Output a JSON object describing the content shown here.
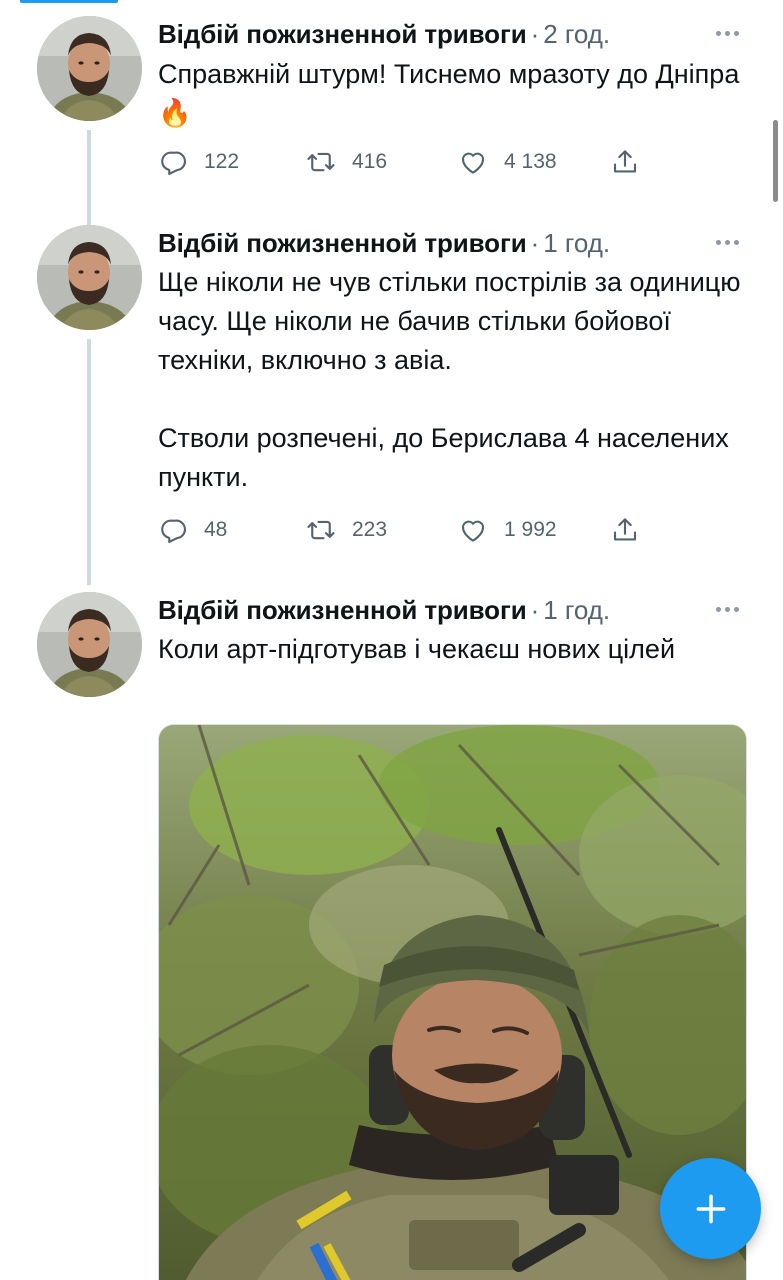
{
  "thread": [
    {
      "author": "Відбій пожизненной тривоги",
      "separator": "·",
      "time": "2 год.",
      "text": "Справжній штурм! Тиснемо мразоту до Дніпра 🔥",
      "replies": "122",
      "retweets": "416",
      "likes": "4 138"
    },
    {
      "author": "Відбій пожизненной тривоги",
      "separator": "·",
      "time": "1 год.",
      "text": "Ще ніколи не чув стільки пострілів за одиницю часу. Ще ніколи не бачив стільки бойової техніки, включно з авіа.\n\nСтволи розпечені, до Берислава 4 населених пункти.",
      "replies": "48",
      "retweets": "223",
      "likes": "1 992"
    },
    {
      "author": "Відбій пожизненной тривоги",
      "separator": "·",
      "time": "1 год.",
      "text": "Коли арт-підготував і чекаєш нових цілей"
    }
  ],
  "icons": {
    "reply": "reply-icon",
    "retweet": "retweet-icon",
    "like": "heart-icon",
    "share": "share-icon",
    "more": "more-icon",
    "compose": "plus-icon"
  },
  "colors": {
    "accent": "#1d9bf0",
    "muted": "#536471",
    "thread_line": "#cfd9de"
  }
}
